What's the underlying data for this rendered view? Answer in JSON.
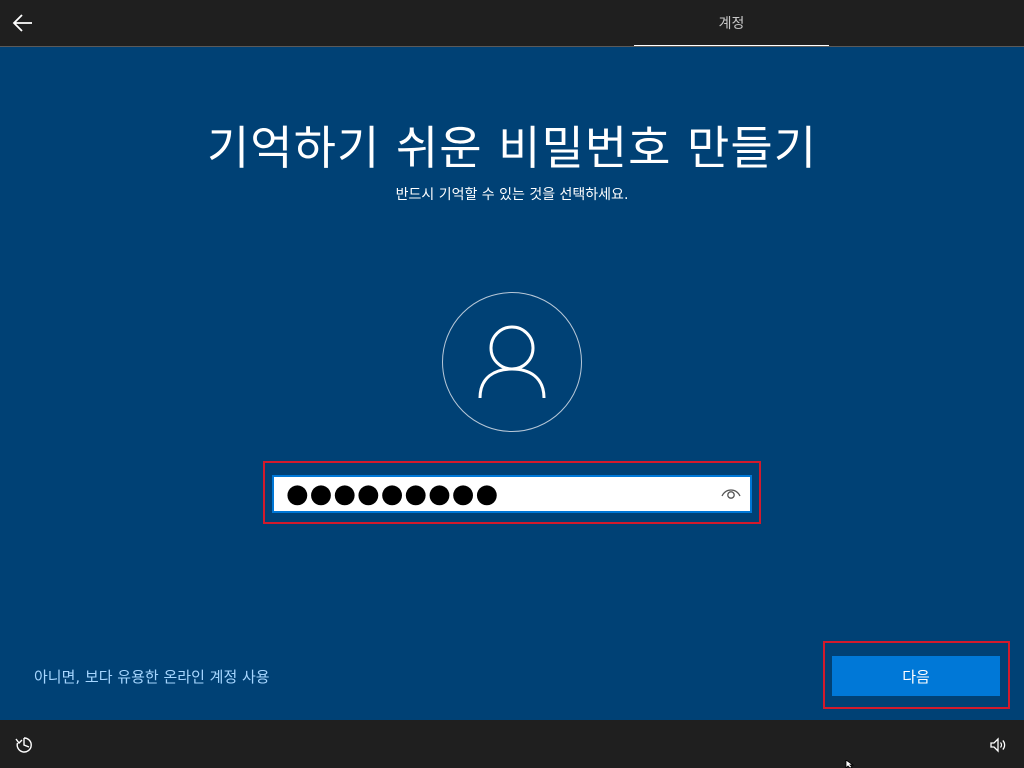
{
  "header": {
    "section_tab": "계정"
  },
  "main": {
    "title": "기억하기 쉬운 비밀번호 만들기",
    "subtitle": "반드시 기억할 수 있는 것을 선택하세요.",
    "password_value": "●●●●●●●●●",
    "alt_link": "아니면, 보다 유용한 온라인 계정 사용",
    "next_label": "다음"
  },
  "icons": {
    "back": "arrow-left-icon",
    "avatar": "user-icon",
    "reveal": "eye-icon",
    "ease_of_access": "ease-of-access-icon",
    "volume": "volume-icon"
  },
  "colors": {
    "background": "#004175",
    "bar": "#1f1f1f",
    "accent": "#0078d7",
    "highlight": "#d21a2c",
    "link": "#a6d6ff"
  }
}
